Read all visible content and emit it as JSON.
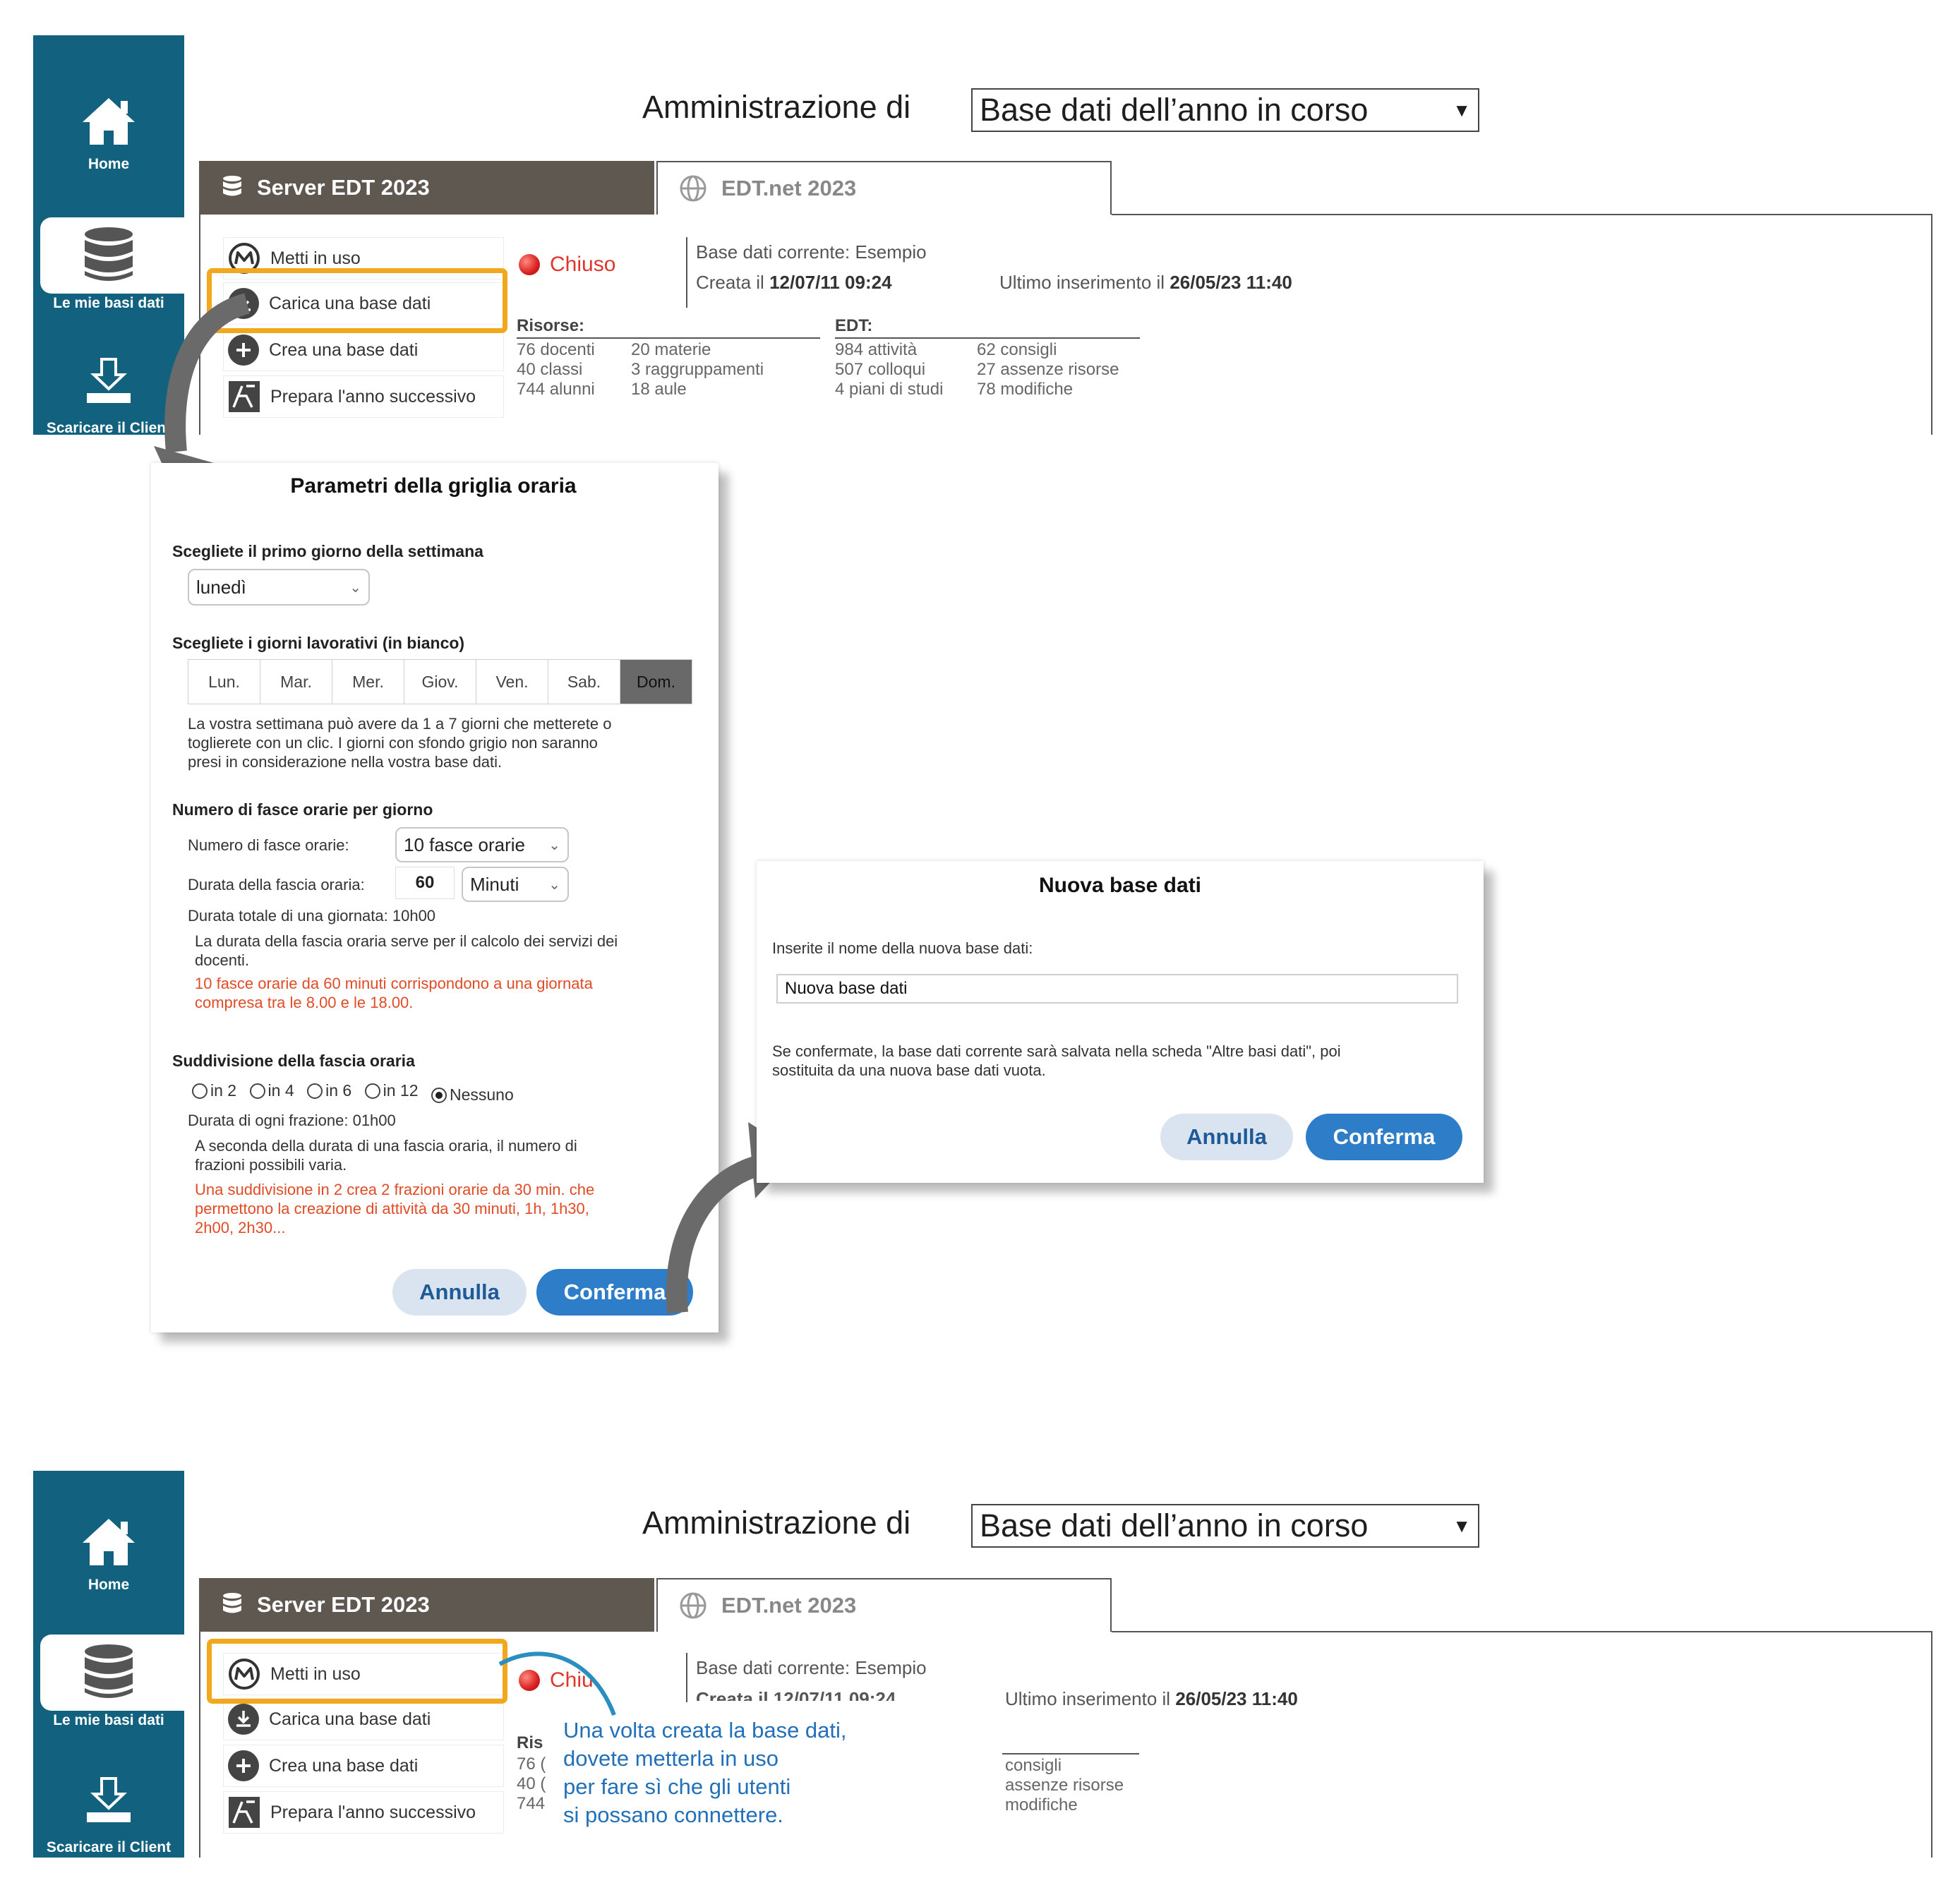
{
  "nav": {
    "home": "Home",
    "my_databases": "Le mie basi dati",
    "download_client": "Scaricare il Client"
  },
  "header": {
    "admin_label": "Amministrazione di",
    "database_select": "Base dati dell’anno in corso"
  },
  "tabs": {
    "server": "Server EDT 2023",
    "edtnet": "EDT.net 2023"
  },
  "actions": {
    "use": "Metti in uso",
    "load": "Carica una base dati",
    "create": "Crea una base dati",
    "prepare": "Prepara l'anno successivo"
  },
  "status": {
    "label": "Chiuso",
    "color": "#e0352b"
  },
  "info": {
    "current_label": "Base dati corrente:",
    "current_value": "Esempio",
    "created_label": "Creata il",
    "created_value": "12/07/11 09:24",
    "last_label": "Ultimo inserimento il",
    "last_value": "26/05/23 11:40",
    "created_partial": "Creata il 12/07/11 09:24"
  },
  "resources": {
    "heading": "Risorse:",
    "col1": [
      "76 docenti",
      "40 classi",
      "744 alunni"
    ],
    "col2": [
      "20 materie",
      "3 raggruppamenti",
      "18 aule"
    ]
  },
  "edt": {
    "heading": "EDT:",
    "col1": [
      "984 attività",
      "507 colloqui",
      "4 piani di studi"
    ],
    "col2": [
      "62 consigli",
      "27 assenze risorse",
      "78 modifiche"
    ]
  },
  "grid_dialog": {
    "title": "Parametri della griglia oraria",
    "first_day_label": "Scegliete il primo giorno della settimana",
    "first_day_value": "lunedì",
    "workdays_label": "Scegliete i giorni lavorativi (in bianco)",
    "days": [
      "Lun.",
      "Mar.",
      "Mer.",
      "Giov.",
      "Ven.",
      "Sab.",
      "Dom."
    ],
    "days_note_1": "La vostra settimana può avere da 1 a 7 giorni che metterete o",
    "days_note_2": "toglierete con un clic. I giorni con sfondo grigio non saranno",
    "days_note_3": "presi in considerazione nella vostra base dati.",
    "slots_heading": "Numero di fasce orarie per giorno",
    "slots_label": "Numero di fasce orarie:",
    "slots_value": "10 fasce orarie",
    "duration_label": "Durata della fascia oraria:",
    "duration_value": "60",
    "duration_unit": "Minuti",
    "total_day": "Durata totale di una giornata: 10h00",
    "duration_note_1": "La durata della fascia oraria serve per il calcolo dei servizi dei",
    "duration_note_2": "docenti.",
    "duration_red_1": "10 fasce orarie da 60 minuti corrispondono a una giornata",
    "duration_red_2": "compresa tra le 8.00 e le 18.00.",
    "subdivision_heading": "Suddivisione della fascia oraria",
    "radios": [
      "in 2",
      "in 4",
      "in 6",
      "in 12",
      "Nessuno"
    ],
    "fraction_duration": "Durata di ogni frazione: 01h00",
    "fraction_note_1": "A seconda della durata di una fascia oraria, il numero di",
    "fraction_note_2": "frazioni possibili varia.",
    "fraction_red_1": "Una suddivisione in 2 crea 2 frazioni orarie da 30 min. che",
    "fraction_red_2": "permettono la creazione di attività da 30 minuti, 1h, 1h30,",
    "fraction_red_3": "2h00, 2h30...",
    "cancel": "Annulla",
    "confirm": "Conferma"
  },
  "new_db_dialog": {
    "title": "Nuova base dati",
    "prompt": "Inserite il nome della nuova base dati:",
    "input_value": "Nuova base dati",
    "note_1": "Se confermate, la base dati corrente sarà salvata nella scheda \"Altre basi dati\", poi",
    "note_2": "sostituita da una nuova base dati vuota.",
    "cancel": "Annulla",
    "confirm": "Conferma"
  },
  "callout": {
    "line1": "Una volta creata la base dati,",
    "line2": "dovete metterla in uso",
    "line3": "per fare sì che gli utenti",
    "line4": "si possano connettere."
  },
  "partial": {
    "status": "Chiu",
    "res_head": "Ris",
    "res1": "76 (",
    "res2": "40 (",
    "res3": "744",
    "edt1": "consigli",
    "edt2": "assenze risorse",
    "edt3": "modifiche"
  },
  "colors": {
    "sidebar": "#12627f",
    "tab_active": "#5e5851",
    "highlight": "#f2a81d",
    "confirm": "#2e7dc9",
    "callout": "#2270b9",
    "warning_text": "#e14b26"
  }
}
